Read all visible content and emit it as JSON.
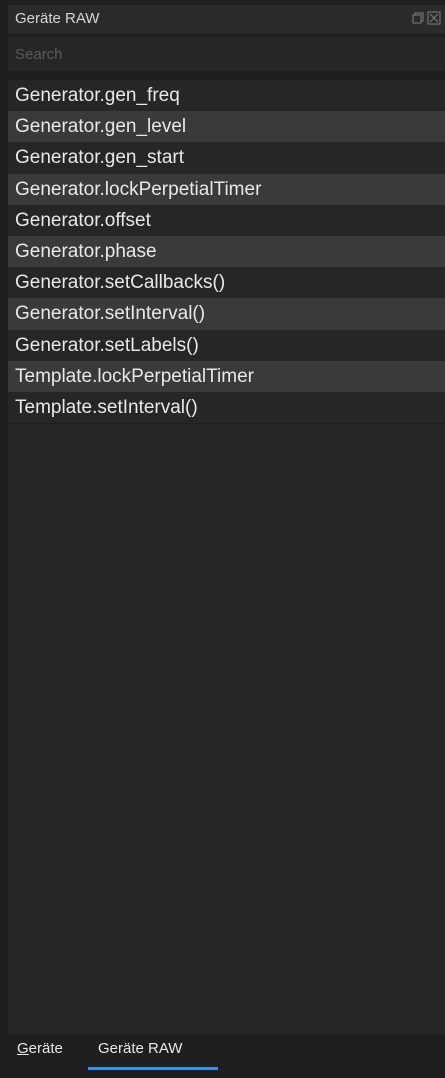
{
  "window": {
    "title": "Geräte RAW",
    "restore_icon": "restore-icon",
    "close_icon": "close-icon"
  },
  "search": {
    "placeholder": "Search",
    "value": ""
  },
  "list": {
    "items": [
      {
        "label": "Generator.gen_freq"
      },
      {
        "label": "Generator.gen_level"
      },
      {
        "label": "Generator.gen_start"
      },
      {
        "label": "Generator.lockPerpetialTimer"
      },
      {
        "label": "Generator.offset"
      },
      {
        "label": "Generator.phase"
      },
      {
        "label": "Generator.setCallbacks()"
      },
      {
        "label": "Generator.setInterval()"
      },
      {
        "label": "Generator.setLabels()"
      },
      {
        "label": "Template.lockPerpetialTimer"
      },
      {
        "label": "Template.setInterval()"
      }
    ]
  },
  "tabs": [
    {
      "label": "Geräte",
      "accel": "G",
      "rest": "eräte",
      "active": false
    },
    {
      "label": "Geräte RAW",
      "active": true
    }
  ],
  "colors": {
    "accent": "#3b8eea"
  }
}
